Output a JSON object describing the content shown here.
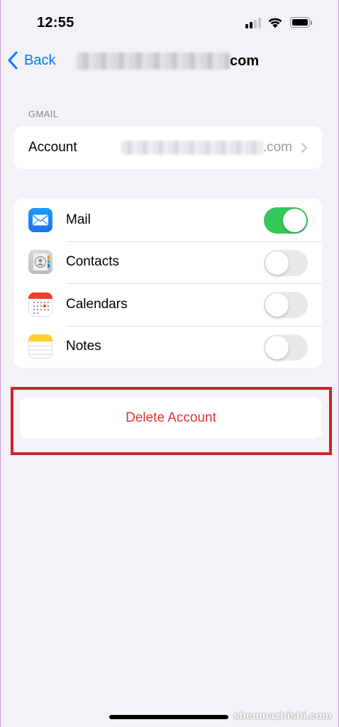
{
  "status_bar": {
    "time": "12:55"
  },
  "nav": {
    "back_label": "Back",
    "title_suffix": "com"
  },
  "section": {
    "header": "GMAIL"
  },
  "account": {
    "label": "Account",
    "value_suffix": ".com"
  },
  "toggles": [
    {
      "label": "Mail",
      "icon": "mail-icon",
      "on": true
    },
    {
      "label": "Contacts",
      "icon": "contacts-icon",
      "on": false
    },
    {
      "label": "Calendars",
      "icon": "calendar-icon",
      "on": false
    },
    {
      "label": "Notes",
      "icon": "notes-icon",
      "on": false
    }
  ],
  "delete": {
    "label": "Delete Account"
  },
  "watermark": "shenmazhishi.com",
  "colors": {
    "accent": "#007aff",
    "switch_on": "#34c759",
    "destructive": "#e5322d",
    "highlight": "#d1222c"
  }
}
